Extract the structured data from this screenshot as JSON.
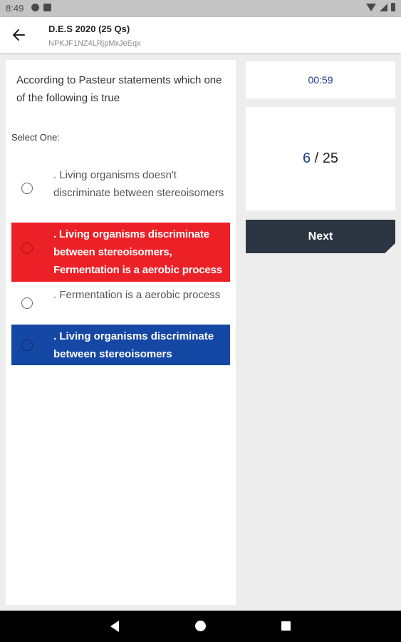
{
  "status_bar": {
    "time": "8:49",
    "left_icons": [
      "data-saver-icon",
      "sd-card-icon"
    ],
    "right_icons": [
      "wifi-icon",
      "signal-icon",
      "battery-icon"
    ]
  },
  "app_bar": {
    "back_icon": "arrow-left-icon",
    "title": "D.E.S 2020 (25 Qs)",
    "subtitle": "NPKJF1NZ4LRjpMxJeEqx"
  },
  "question": {
    "text": "According to Pasteur statements which one of the following is true",
    "select_label": "Select One:",
    "options": [
      {
        "label": ". Living organisms doesn't discriminate between stereoisomers",
        "state": "default"
      },
      {
        "label": ". Living organisms discriminate between stereoisomers, Fermentation is a aerobic process",
        "state": "wrong"
      },
      {
        "label": ". Fermentation is a aerobic process",
        "state": "default"
      },
      {
        "label": ". Living organisms discriminate between stereoisomers",
        "state": "correct"
      }
    ]
  },
  "timer": {
    "value": "00:59"
  },
  "progress": {
    "current": "6",
    "separator": " / ",
    "total": "25"
  },
  "next_button": {
    "label": "Next"
  },
  "colors": {
    "wrong": "#ec2127",
    "correct": "#1547a4",
    "accent": "#1a3e8a",
    "next_button": "#2b3642"
  },
  "nav_bar": {
    "icons": [
      "nav-back-icon",
      "nav-home-icon",
      "nav-recents-icon"
    ]
  }
}
